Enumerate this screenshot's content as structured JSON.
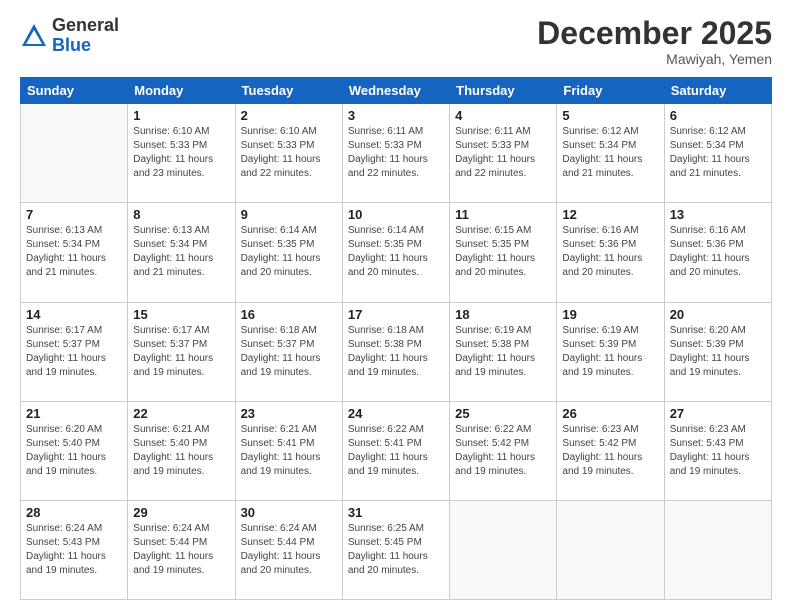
{
  "logo": {
    "general": "General",
    "blue": "Blue"
  },
  "header": {
    "month": "December 2025",
    "location": "Mawiyah, Yemen"
  },
  "days_of_week": [
    "Sunday",
    "Monday",
    "Tuesday",
    "Wednesday",
    "Thursday",
    "Friday",
    "Saturday"
  ],
  "weeks": [
    [
      {
        "day": "",
        "info": ""
      },
      {
        "day": "1",
        "info": "Sunrise: 6:10 AM\nSunset: 5:33 PM\nDaylight: 11 hours\nand 23 minutes."
      },
      {
        "day": "2",
        "info": "Sunrise: 6:10 AM\nSunset: 5:33 PM\nDaylight: 11 hours\nand 22 minutes."
      },
      {
        "day": "3",
        "info": "Sunrise: 6:11 AM\nSunset: 5:33 PM\nDaylight: 11 hours\nand 22 minutes."
      },
      {
        "day": "4",
        "info": "Sunrise: 6:11 AM\nSunset: 5:33 PM\nDaylight: 11 hours\nand 22 minutes."
      },
      {
        "day": "5",
        "info": "Sunrise: 6:12 AM\nSunset: 5:34 PM\nDaylight: 11 hours\nand 21 minutes."
      },
      {
        "day": "6",
        "info": "Sunrise: 6:12 AM\nSunset: 5:34 PM\nDaylight: 11 hours\nand 21 minutes."
      }
    ],
    [
      {
        "day": "7",
        "info": "Sunrise: 6:13 AM\nSunset: 5:34 PM\nDaylight: 11 hours\nand 21 minutes."
      },
      {
        "day": "8",
        "info": "Sunrise: 6:13 AM\nSunset: 5:34 PM\nDaylight: 11 hours\nand 21 minutes."
      },
      {
        "day": "9",
        "info": "Sunrise: 6:14 AM\nSunset: 5:35 PM\nDaylight: 11 hours\nand 20 minutes."
      },
      {
        "day": "10",
        "info": "Sunrise: 6:14 AM\nSunset: 5:35 PM\nDaylight: 11 hours\nand 20 minutes."
      },
      {
        "day": "11",
        "info": "Sunrise: 6:15 AM\nSunset: 5:35 PM\nDaylight: 11 hours\nand 20 minutes."
      },
      {
        "day": "12",
        "info": "Sunrise: 6:16 AM\nSunset: 5:36 PM\nDaylight: 11 hours\nand 20 minutes."
      },
      {
        "day": "13",
        "info": "Sunrise: 6:16 AM\nSunset: 5:36 PM\nDaylight: 11 hours\nand 20 minutes."
      }
    ],
    [
      {
        "day": "14",
        "info": "Sunrise: 6:17 AM\nSunset: 5:37 PM\nDaylight: 11 hours\nand 19 minutes."
      },
      {
        "day": "15",
        "info": "Sunrise: 6:17 AM\nSunset: 5:37 PM\nDaylight: 11 hours\nand 19 minutes."
      },
      {
        "day": "16",
        "info": "Sunrise: 6:18 AM\nSunset: 5:37 PM\nDaylight: 11 hours\nand 19 minutes."
      },
      {
        "day": "17",
        "info": "Sunrise: 6:18 AM\nSunset: 5:38 PM\nDaylight: 11 hours\nand 19 minutes."
      },
      {
        "day": "18",
        "info": "Sunrise: 6:19 AM\nSunset: 5:38 PM\nDaylight: 11 hours\nand 19 minutes."
      },
      {
        "day": "19",
        "info": "Sunrise: 6:19 AM\nSunset: 5:39 PM\nDaylight: 11 hours\nand 19 minutes."
      },
      {
        "day": "20",
        "info": "Sunrise: 6:20 AM\nSunset: 5:39 PM\nDaylight: 11 hours\nand 19 minutes."
      }
    ],
    [
      {
        "day": "21",
        "info": "Sunrise: 6:20 AM\nSunset: 5:40 PM\nDaylight: 11 hours\nand 19 minutes."
      },
      {
        "day": "22",
        "info": "Sunrise: 6:21 AM\nSunset: 5:40 PM\nDaylight: 11 hours\nand 19 minutes."
      },
      {
        "day": "23",
        "info": "Sunrise: 6:21 AM\nSunset: 5:41 PM\nDaylight: 11 hours\nand 19 minutes."
      },
      {
        "day": "24",
        "info": "Sunrise: 6:22 AM\nSunset: 5:41 PM\nDaylight: 11 hours\nand 19 minutes."
      },
      {
        "day": "25",
        "info": "Sunrise: 6:22 AM\nSunset: 5:42 PM\nDaylight: 11 hours\nand 19 minutes."
      },
      {
        "day": "26",
        "info": "Sunrise: 6:23 AM\nSunset: 5:42 PM\nDaylight: 11 hours\nand 19 minutes."
      },
      {
        "day": "27",
        "info": "Sunrise: 6:23 AM\nSunset: 5:43 PM\nDaylight: 11 hours\nand 19 minutes."
      }
    ],
    [
      {
        "day": "28",
        "info": "Sunrise: 6:24 AM\nSunset: 5:43 PM\nDaylight: 11 hours\nand 19 minutes."
      },
      {
        "day": "29",
        "info": "Sunrise: 6:24 AM\nSunset: 5:44 PM\nDaylight: 11 hours\nand 19 minutes."
      },
      {
        "day": "30",
        "info": "Sunrise: 6:24 AM\nSunset: 5:44 PM\nDaylight: 11 hours\nand 20 minutes."
      },
      {
        "day": "31",
        "info": "Sunrise: 6:25 AM\nSunset: 5:45 PM\nDaylight: 11 hours\nand 20 minutes."
      },
      {
        "day": "",
        "info": ""
      },
      {
        "day": "",
        "info": ""
      },
      {
        "day": "",
        "info": ""
      }
    ]
  ]
}
